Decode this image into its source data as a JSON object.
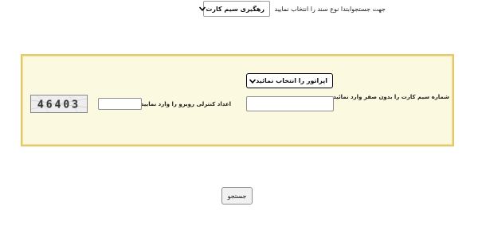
{
  "search_bar": {
    "doc_type_label": "جهت جستجوابتدا نوع سند را انتخاب نمایید",
    "doc_type_selected": "رهگیری سیم کارت",
    "chevron_icon": "chevron-down-icon"
  },
  "form": {
    "operator_selected": "اپراتور را انتخاب نمائید",
    "sim_label": "شماره سیم کارت را بدون صفر وارد نمائید",
    "sim_value": "",
    "captcha_label": "اعداد کنترلی روبرو را وارد نمایید:",
    "captcha_value": "",
    "captcha_code": "46403"
  },
  "actions": {
    "search_label": "جستجو"
  },
  "colors": {
    "panel_background": "#fbf9df",
    "panel_border": "#e7c865"
  }
}
